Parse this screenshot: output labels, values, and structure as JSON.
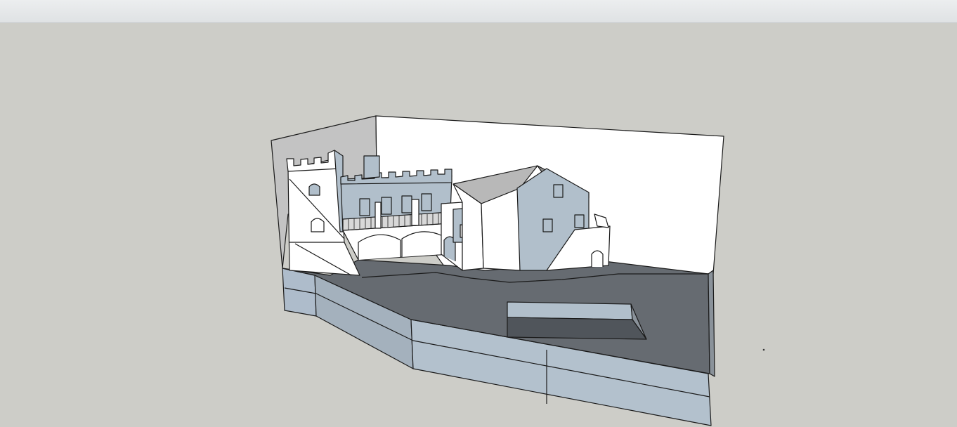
{
  "app": {
    "window_title": ""
  },
  "viewport": {
    "background_color": "#cdcdc8",
    "model": {
      "description_visible": false,
      "colors": {
        "ground": "#666b71",
        "front_face": "#b1bfcb",
        "side_face": "#a4b1bd",
        "wall_white": "#ffffff",
        "wall_grey": "#c3c3c3",
        "roof": "#b8b8b8",
        "edge": "#1a1a1a"
      }
    }
  }
}
